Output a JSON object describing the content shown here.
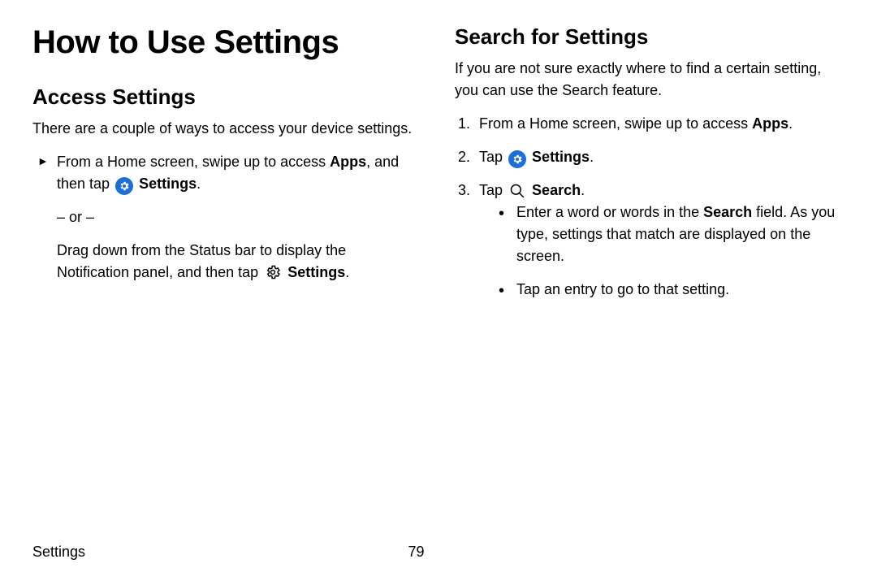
{
  "page": {
    "title": "How to Use Settings",
    "footer_section": "Settings",
    "footer_page": "79"
  },
  "left": {
    "heading": "Access Settings",
    "intro": "There are a couple of ways to access your device settings.",
    "step1_a": "From a Home screen, swipe up to access ",
    "step1_apps": "Apps",
    "step1_b": ", and then tap ",
    "step1_settings": "Settings",
    "or": "– or –",
    "step2_a": "Drag down from the Status bar to display the Notification panel, and then tap ",
    "step2_settings": "Settings"
  },
  "right": {
    "heading": "Search for Settings",
    "intro": "If you are not sure exactly where to find a certain setting, you can use the Search feature.",
    "s1_a": "From a Home screen, swipe up to access ",
    "s1_apps": "Apps",
    "s2_a": "Tap ",
    "s2_settings": "Settings",
    "s3_a": "Tap ",
    "s3_search": "Search",
    "b1_a": "Enter a word or words in the ",
    "b1_search": "Search",
    "b1_b": " field. As you type, settings that match are displayed on the screen.",
    "b2": "Tap an entry to go to that setting."
  }
}
